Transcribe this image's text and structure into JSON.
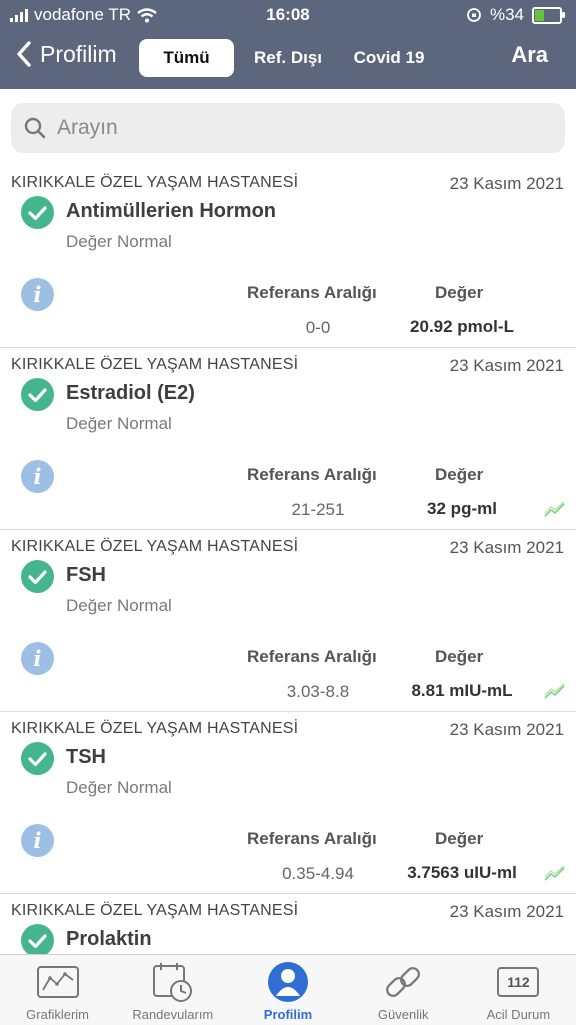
{
  "status_bar": {
    "carrier": "vodafone TR",
    "time": "16:08",
    "battery": "%34"
  },
  "header": {
    "back_label": "Profilim",
    "segments": [
      {
        "label": "Tümü",
        "active": true
      },
      {
        "label": "Ref. Dışı",
        "active": false
      },
      {
        "label": "Covid 19",
        "active": false
      }
    ],
    "search_action": "Ara"
  },
  "search": {
    "placeholder": "Arayın"
  },
  "results": [
    {
      "hospital": "KIRIKKALE ÖZEL YAŞAM HASTANESİ",
      "date": "23 Kasım 2021",
      "test": "Antimüllerien Hormon",
      "status": "Değer Normal",
      "ref_label": "Referans Aralığı",
      "value_label": "Değer",
      "ref_range": "0-0",
      "value": "20.92 pmol-L",
      "has_trend": false
    },
    {
      "hospital": "KIRIKKALE ÖZEL YAŞAM HASTANESİ",
      "date": "23 Kasım 2021",
      "test": "Estradiol (E2)",
      "status": "Değer Normal",
      "ref_label": "Referans Aralığı",
      "value_label": "Değer",
      "ref_range": "21-251",
      "value": "32 pg-ml",
      "has_trend": true
    },
    {
      "hospital": "KIRIKKALE ÖZEL YAŞAM HASTANESİ",
      "date": "23 Kasım 2021",
      "test": "FSH",
      "status": "Değer Normal",
      "ref_label": "Referans Aralığı",
      "value_label": "Değer",
      "ref_range": "3.03-8.8",
      "value": "8.81 mIU-mL",
      "has_trend": true
    },
    {
      "hospital": "KIRIKKALE ÖZEL YAŞAM HASTANESİ",
      "date": "23 Kasım 2021",
      "test": "TSH",
      "status": "Değer Normal",
      "ref_label": "Referans Aralığı",
      "value_label": "Değer",
      "ref_range": "0.35-4.94",
      "value": "3.7563 uIU-ml",
      "has_trend": true
    },
    {
      "hospital": "KIRIKKALE ÖZEL YAŞAM HASTANESİ",
      "date": "23 Kasım 2021",
      "test": "Prolaktin",
      "status": "",
      "ref_label": "",
      "value_label": "",
      "ref_range": "",
      "value": "",
      "has_trend": false
    }
  ],
  "tabbar": [
    {
      "label": "Grafiklerim",
      "icon": "chart-icon",
      "active": false
    },
    {
      "label": "Randevularım",
      "icon": "calendar-clock-icon",
      "active": false
    },
    {
      "label": "Profilim",
      "icon": "profile-icon",
      "active": true
    },
    {
      "label": "Güvenlik",
      "icon": "link-icon",
      "active": false
    },
    {
      "label": "Acil Durum",
      "icon": "emergency-112-icon",
      "text": "112",
      "active": false
    }
  ],
  "colors": {
    "header_bg": "#5c677d",
    "check_green": "#45b58c",
    "info_blue": "#9dbfe3",
    "active_tab": "#2f6fd4"
  }
}
